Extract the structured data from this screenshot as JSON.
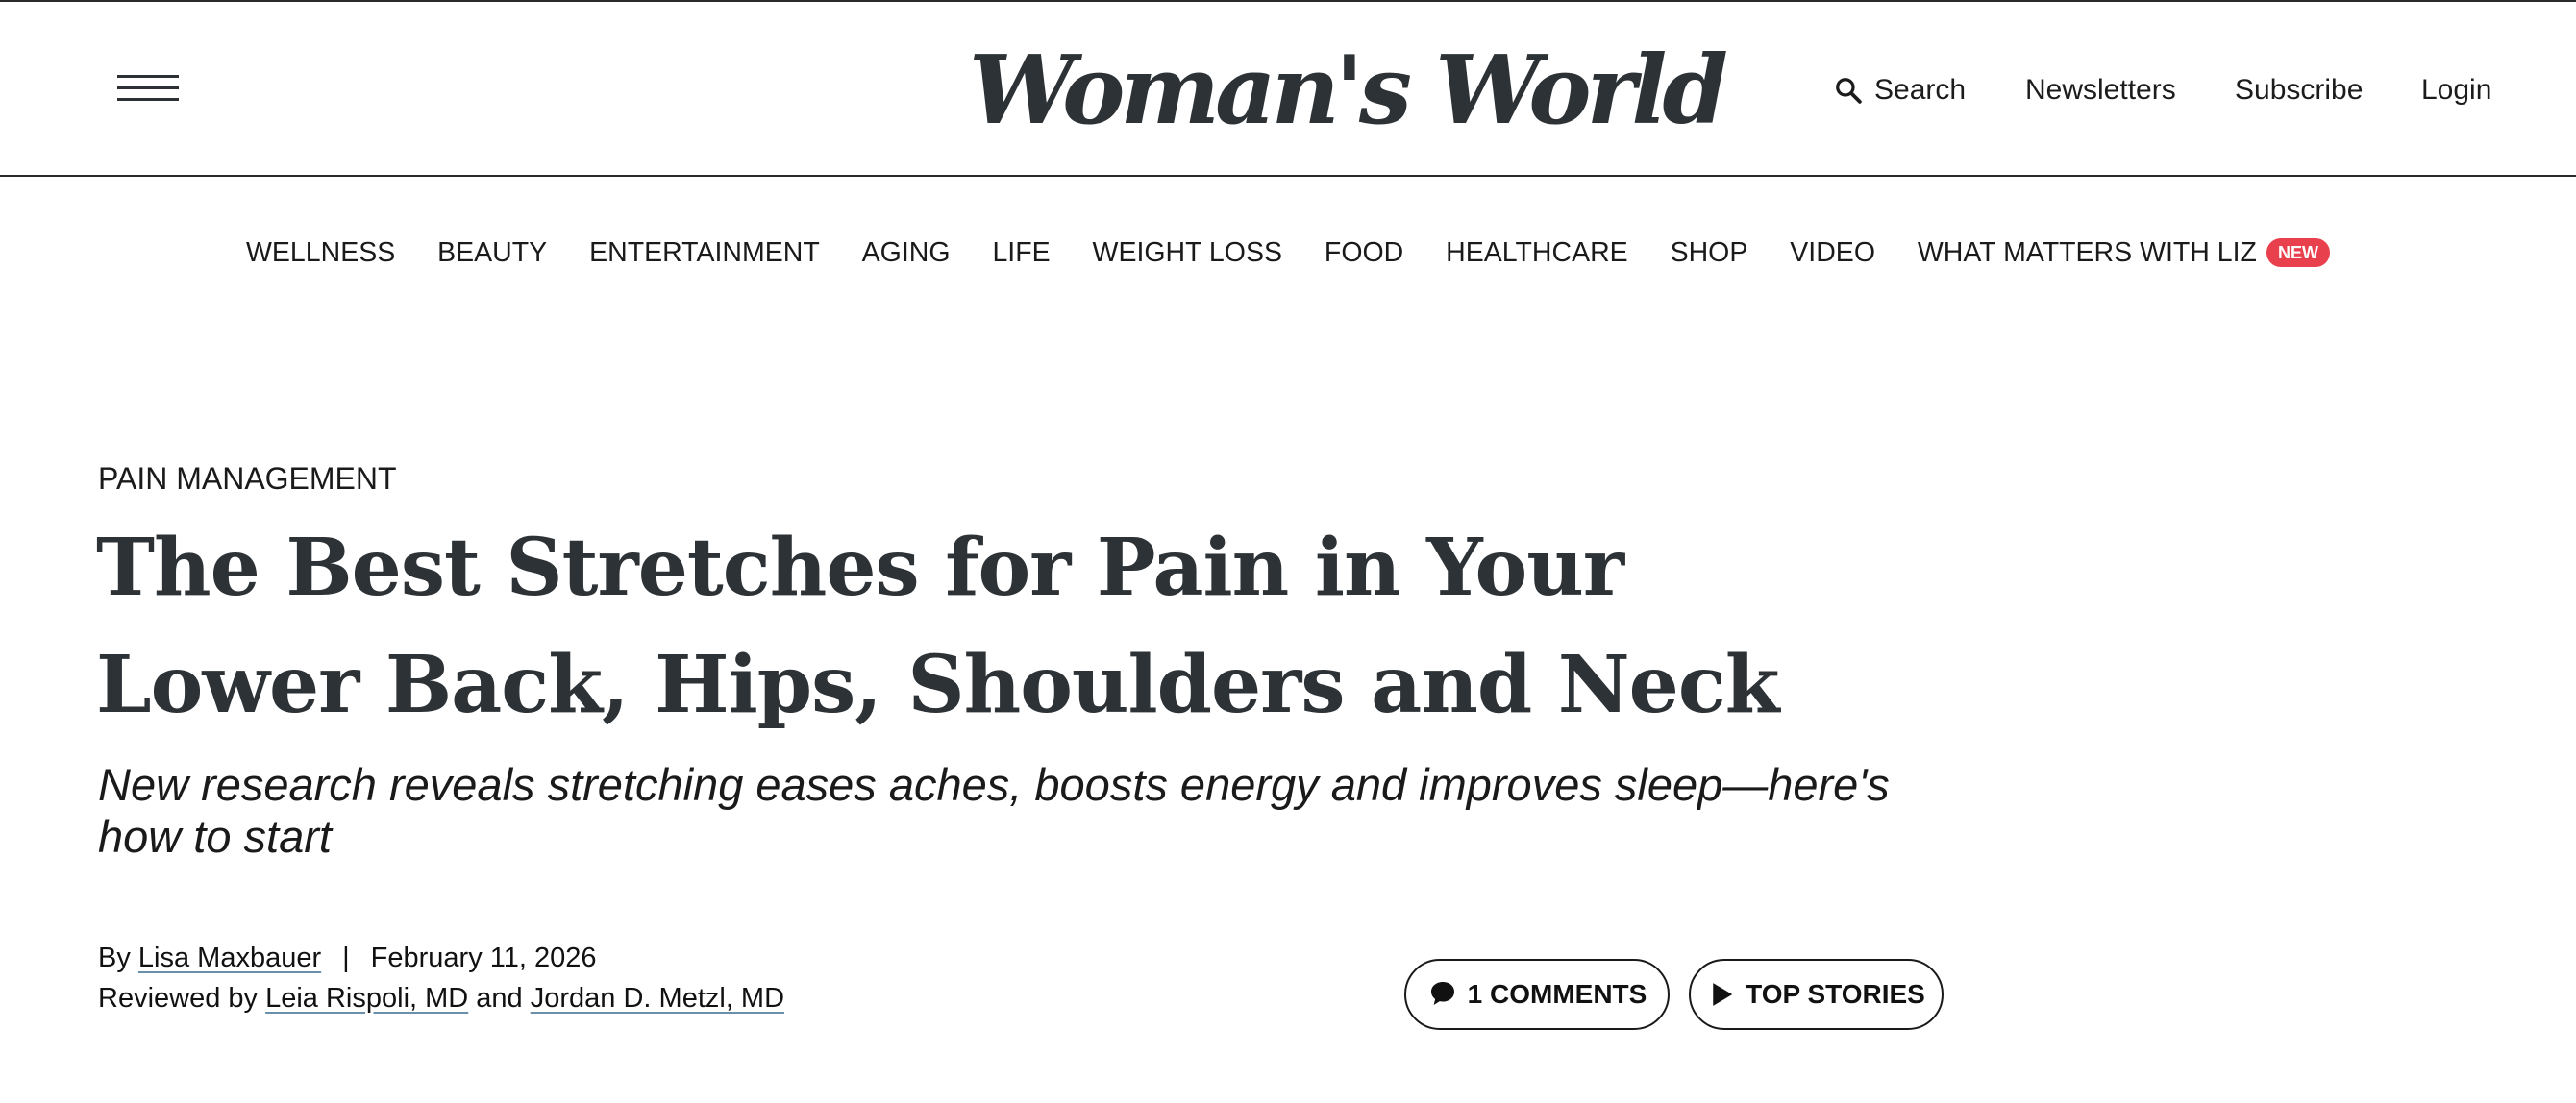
{
  "header": {
    "logo_text": "Woman's World",
    "search_label": "Search",
    "newsletters_label": "Newsletters",
    "subscribe_label": "Subscribe",
    "login_label": "Login",
    "icons": [
      "menu-icon",
      "search-icon"
    ]
  },
  "nav": {
    "items": [
      "WELLNESS",
      "BEAUTY",
      "ENTERTAINMENT",
      "AGING",
      "LIFE",
      "WEIGHT LOSS",
      "FOOD",
      "HEALTHCARE",
      "SHOP",
      "VIDEO",
      "WHAT MATTERS WITH LIZ"
    ],
    "new_badge": "NEW",
    "badge_color": "#e8404c"
  },
  "article": {
    "category": "PAIN MANAGEMENT",
    "title": "The Best Stretches for Pain in Your Lower Back, Hips, Shoulders and Neck",
    "subtitle": "New research reveals stretching eases aches, boosts energy and improves sleep—here's how to start",
    "by_prefix": "By",
    "author": "Lisa Maxbauer",
    "separator": "|",
    "date": "February 11, 2026",
    "reviewed_prefix": "Reviewed by",
    "reviewer_1": "Leia Rispoli, MD",
    "reviewer_joiner": "and",
    "reviewer_2": "Jordan D. Metzl, MD"
  },
  "actions": {
    "comments_label": "1 COMMENTS",
    "top_stories_label": "TOP STORIES",
    "icons": [
      "comment-icon",
      "play-icon"
    ]
  },
  "colors": {
    "text_dark": "#2d3236",
    "border": "#2b2b2b",
    "link_underline": "#6a8fa8"
  }
}
